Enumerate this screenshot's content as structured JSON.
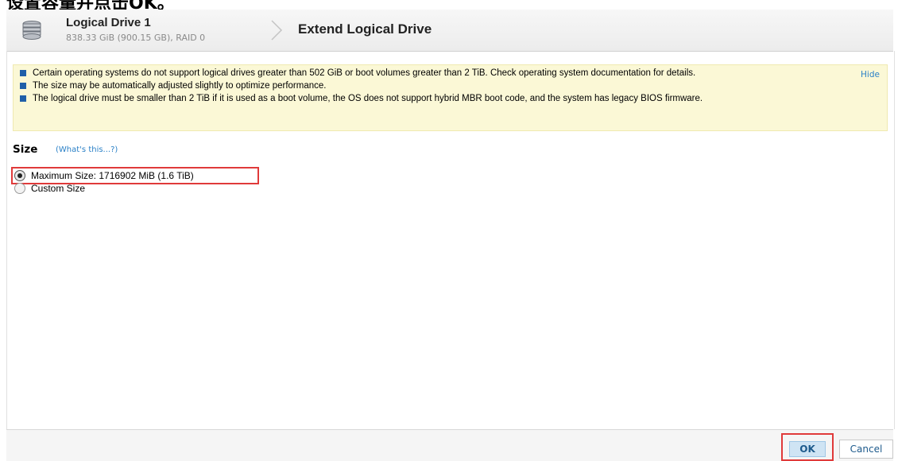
{
  "caption": "设置容量并点击OK。",
  "header": {
    "drive_name": "Logical Drive 1",
    "drive_details": "838.33 GiB (900.15 GB), RAID 0",
    "page_title": "Extend Logical Drive"
  },
  "notice": {
    "items": [
      "Certain operating systems do not support logical drives greater than 502 GiB or boot volumes greater than 2 TiB. Check operating system documentation for details.",
      "The size may be automatically adjusted slightly to optimize performance.",
      "The logical drive must be smaller than 2 TiB if it is used as a boot volume, the OS does not support hybrid MBR boot code, and the system has legacy BIOS firmware."
    ],
    "hide_label": "Hide"
  },
  "size": {
    "heading": "Size",
    "whats_this": "(What's this...?)",
    "options": [
      {
        "label": "Maximum Size: 1716902 MiB (1.6 TiB)",
        "selected": true
      },
      {
        "label": "Custom Size",
        "selected": false
      }
    ]
  },
  "footer": {
    "ok_label": "OK",
    "cancel_label": "Cancel"
  },
  "colors": {
    "accent": "#2a80c7",
    "bullet": "#1f5fa8",
    "notice_bg": "#fbf8d6",
    "highlight": "#e03a3a"
  },
  "icons": {
    "drive": "logical-drive-icon",
    "separator": "chevron-right-icon"
  }
}
